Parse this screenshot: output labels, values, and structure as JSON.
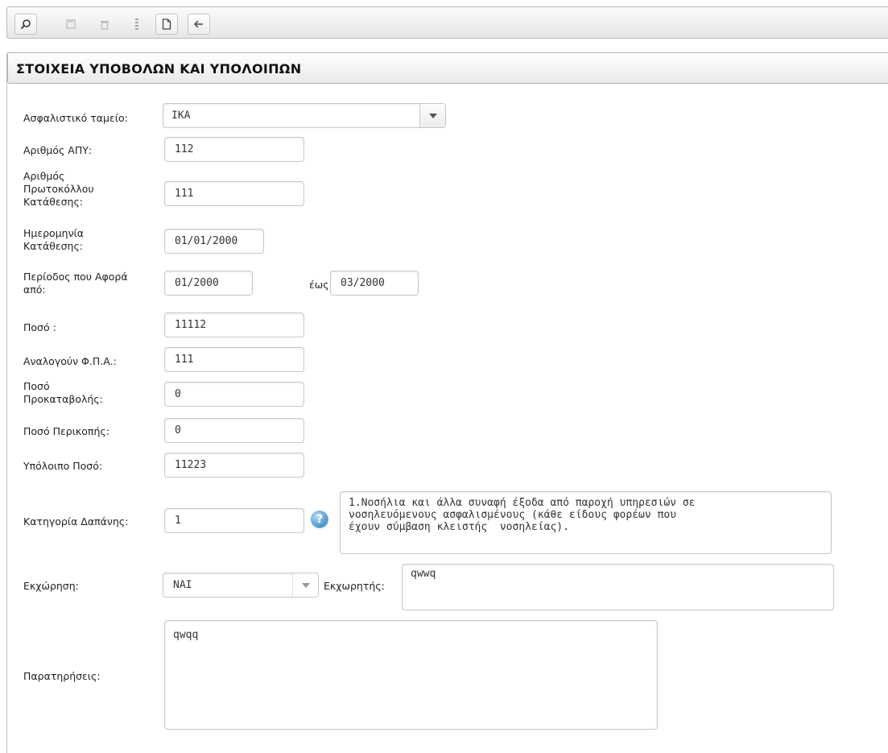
{
  "panel": {
    "title": "ΣΤΟΙΧΕΙΑ ΥΠΟΒΟΛΩΝ ΚΑΙ ΥΠΟΛΟΙΠΩΝ"
  },
  "toolbar": {
    "icons": [
      "search-icon",
      "save-icon",
      "delete-icon",
      "new-document-icon",
      "back-arrow-icon"
    ]
  },
  "form": {
    "fund_label": "Ασφαλιστικό ταμείο:",
    "fund_value": "ΙΚΑ",
    "apy_label": "Αριθμός ΑΠΥ:",
    "apy_value": "112",
    "protocol_label_1": "Αριθμός",
    "protocol_label_2": "Πρωτοκόλλου",
    "protocol_label_3": "Κατάθεσης:",
    "protocol_value": "111",
    "date_label_1": "Ημερομηνία",
    "date_label_2": "Κατάθεσης:",
    "date_value": "01/01/2000",
    "period_label_1": "Περίοδος που Αφορά",
    "period_label_2": "από:",
    "period_from": "01/2000",
    "period_to_label": "έως:",
    "period_to": "03/2000",
    "amount_label": "Ποσό :",
    "amount_value": "11112",
    "vat_label": "Αναλογούν Φ.Π.Α.:",
    "vat_value": "111",
    "advance_label_1": "Ποσό",
    "advance_label_2": "Προκαταβολής:",
    "advance_value": "0",
    "cut_label": "Ποσό Περικοπής:",
    "cut_value": "0",
    "remaining_label": "Υπόλοιπο Ποσό:",
    "remaining_value": "11223",
    "category_label": "Κατηγορία Δαπάνης:",
    "category_value": "1",
    "category_description": "1.Νοσήλια και άλλα συναφή έξοδα από παροχή υπηρεσιών σε\nνοσηλευόμενους ασφαλισμένους (κάθε είδους φορέων που\nέχουν σύμβαση κλειστής  νοσηλείας).",
    "assignment_label": "Εκχώρηση:",
    "assignment_value": "ΝΑΙ",
    "assignee_label": "Εκχωρητής:",
    "assignee_value": "qwwq",
    "remarks_label": "Παρατηρήσεις:",
    "remarks_value": "qwqq"
  },
  "colors": {
    "help_icon": "#4b97c9",
    "border": "#c8c8c8"
  }
}
